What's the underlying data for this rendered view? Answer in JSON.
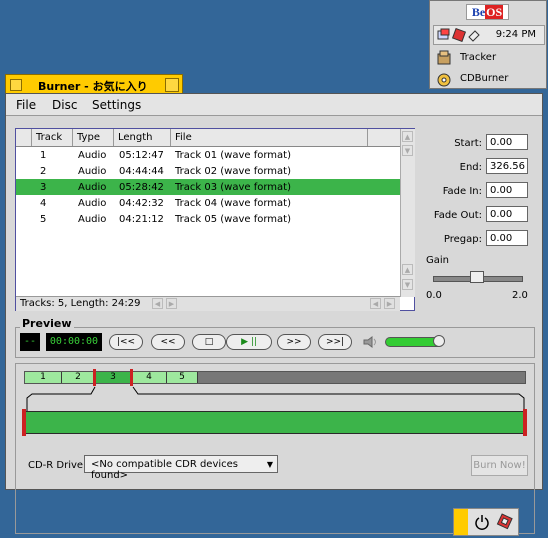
{
  "deskbar": {
    "logo_be": "Be",
    "logo_os": "OS",
    "clock": "9:24 PM",
    "items": [
      {
        "label": "Tracker",
        "icon": "tracker-icon"
      },
      {
        "label": "CDBurner",
        "icon": "cdburner-icon"
      }
    ]
  },
  "window": {
    "title": "Burner - お気に入り",
    "menus": [
      "File",
      "Disc",
      "Settings"
    ]
  },
  "tracklist": {
    "columns": [
      "Track",
      "Type",
      "Length",
      "File"
    ],
    "rows": [
      {
        "track": "1",
        "type": "Audio",
        "length": "05:12:47",
        "file": "Track 01 (wave format)"
      },
      {
        "track": "2",
        "type": "Audio",
        "length": "04:44:44",
        "file": "Track 02 (wave format)"
      },
      {
        "track": "3",
        "type": "Audio",
        "length": "05:28:42",
        "file": "Track 03 (wave format)",
        "selected": true
      },
      {
        "track": "4",
        "type": "Audio",
        "length": "04:42:32",
        "file": "Track 04 (wave format)"
      },
      {
        "track": "5",
        "type": "Audio",
        "length": "04:21:12",
        "file": "Track 05 (wave format)"
      }
    ],
    "status": "Tracks: 5, Length: 24:29"
  },
  "fields": {
    "start_label": "Start:",
    "start": "0.00",
    "end_label": "End:",
    "end": "326.56",
    "fade_in_label": "Fade In:",
    "fade_in": "0.00",
    "fade_out_label": "Fade Out:",
    "fade_out": "0.00",
    "pregap_label": "Pregap:",
    "pregap": "0.00"
  },
  "gain": {
    "label": "Gain",
    "min": "0.0",
    "max": "2.0",
    "value": 1.0
  },
  "preview": {
    "title": "Preview",
    "track_display": "--",
    "time_display": "00:00:00",
    "buttons": [
      "|<<",
      "<<",
      "□",
      "▶ ||",
      ">>",
      ">>|"
    ]
  },
  "strip": {
    "segments": [
      "1",
      "2",
      "3",
      "4",
      "5"
    ],
    "selected": "3"
  },
  "cdr": {
    "label": "CD-R Drive:",
    "device": "<No compatible CDR devices found>",
    "burn": "Burn Now!"
  },
  "colors": {
    "selection": "#3cb44a",
    "tab": "#ffcb00",
    "desktop": "#336698"
  }
}
